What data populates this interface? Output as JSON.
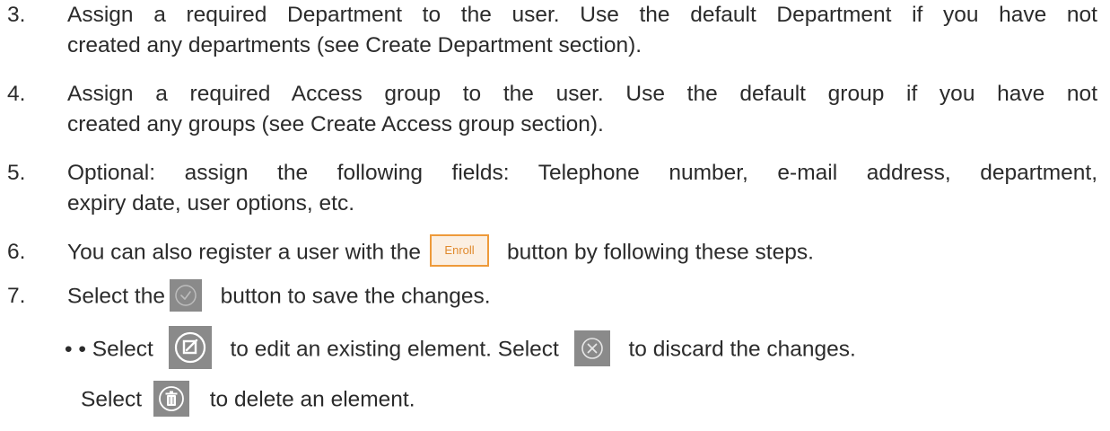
{
  "steps": [
    {
      "num": "3.",
      "line1": "Assign a required Department to the user. Use the default Department if you have not",
      "line2": "created any departments (see Create Department section)."
    },
    {
      "num": "4.",
      "line1": "Assign a required Access group to the user. Use the default group if you have not",
      "line2": "created any groups (see Create Access group section)."
    },
    {
      "num": "5.",
      "line1": "Optional: assign the following fields: Telephone number, e-mail address, department,",
      "line2": "expiry date, user options, etc."
    },
    {
      "num": "6.",
      "before": "You can also register a user with the",
      "button": "Enroll",
      "after": "button by following these steps."
    },
    {
      "num": "7.",
      "before": "Select the",
      "after": "button to save the changes."
    }
  ],
  "notes": {
    "bullet": "• • Select",
    "edit_text": "to edit an existing element. Select",
    "discard_text": "to discard the changes.",
    "delete_before": "Select",
    "delete_after": "to delete an element."
  },
  "icons": {
    "save": "check-circle-icon",
    "edit": "edit-icon",
    "discard": "close-circle-icon",
    "delete": "trash-icon"
  },
  "colors": {
    "text": "#2b2b2b",
    "enroll_border": "#ee9a3a",
    "enroll_fill": "#fbefe2",
    "icon_tile": "#8a8a8a"
  }
}
